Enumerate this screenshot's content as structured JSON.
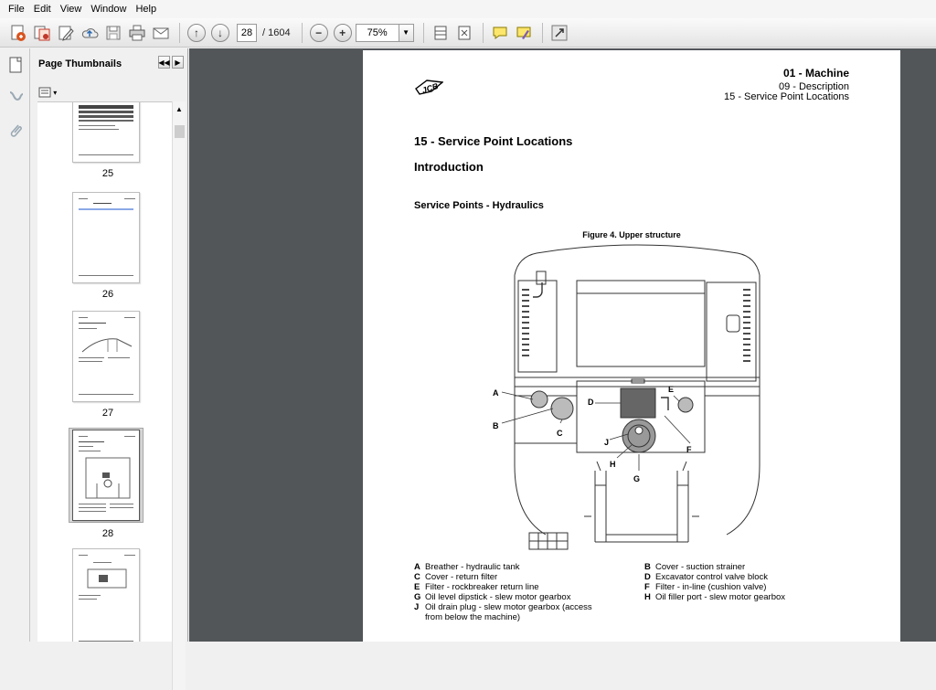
{
  "menu": [
    "File",
    "Edit",
    "View",
    "Window",
    "Help"
  ],
  "toolbar": {
    "current_page": "28",
    "page_total": "/ 1604",
    "zoom": "75%"
  },
  "panel": {
    "title": "Page Thumbnails",
    "thumbnails": [
      {
        "label": "25"
      },
      {
        "label": "26"
      },
      {
        "label": "27"
      },
      {
        "label": "28"
      },
      {
        "label": ""
      }
    ]
  },
  "document": {
    "header_main": "01 - Machine",
    "header_sub": "09 - Description",
    "header_sub2": "15 - Service Point Locations",
    "section_title": "15 - Service Point Locations",
    "intro_heading": "Introduction",
    "subheading": "Service Points - Hydraulics",
    "figure_caption": "Figure 4. Upper structure",
    "callouts": [
      "A",
      "B",
      "C",
      "D",
      "E",
      "F",
      "G",
      "H",
      "J"
    ],
    "legend_left": [
      {
        "key": "A",
        "text": "Breather - hydraulic tank"
      },
      {
        "key": "C",
        "text": "Cover - return filter"
      },
      {
        "key": "E",
        "text": "Filter - rockbreaker return line"
      },
      {
        "key": "G",
        "text": "Oil level dipstick - slew motor gearbox"
      },
      {
        "key": "J",
        "text": "Oil drain plug - slew motor gearbox (access"
      },
      {
        "key": "",
        "text": "from below the machine)"
      }
    ],
    "legend_right": [
      {
        "key": "B",
        "text": "Cover - suction strainer"
      },
      {
        "key": "D",
        "text": "Excavator control valve block"
      },
      {
        "key": "F",
        "text": "Filter - in-line (cushion valve)"
      },
      {
        "key": "H",
        "text": "Oil filler port - slew motor gearbox"
      }
    ]
  }
}
